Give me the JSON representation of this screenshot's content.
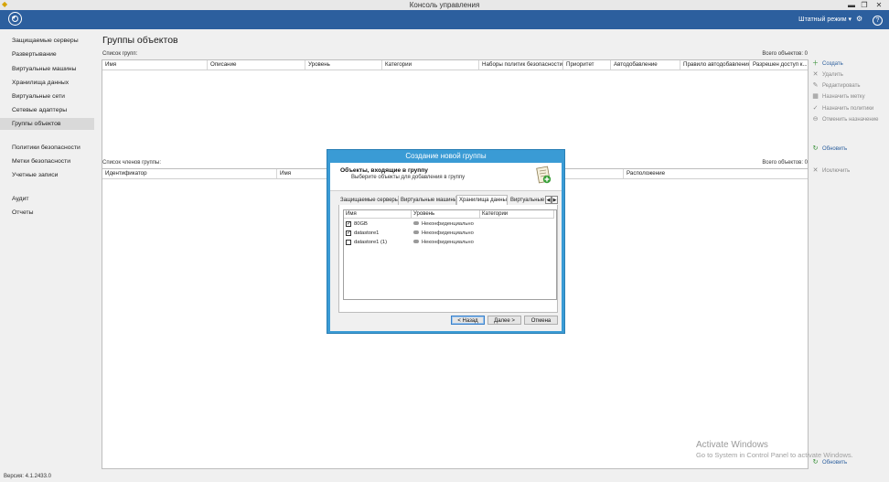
{
  "window": {
    "title": "Консоль управления",
    "minimize": "▬",
    "maximize": "❐",
    "close": "✕"
  },
  "header": {
    "mode_label": "Штатный режим",
    "dropdown_icon": "▾",
    "settings_icon": "⚙",
    "help_icon": "?"
  },
  "sidebar": {
    "items": [
      {
        "label": "Защищаемые серверы"
      },
      {
        "label": "Развертывание"
      },
      {
        "label": "Виртуальные машины"
      },
      {
        "label": "Хранилища данных"
      },
      {
        "label": "Виртуальные сети"
      },
      {
        "label": "Сетевые адаптеры"
      },
      {
        "label": "Группы объектов"
      },
      {
        "label": "Политики безопасности"
      },
      {
        "label": "Метки безопасности"
      },
      {
        "label": "Учетные записи"
      },
      {
        "label": "Аудит"
      },
      {
        "label": "Отчеты"
      }
    ]
  },
  "main": {
    "title": "Группы объектов",
    "groups_label": "Список групп:",
    "groups_count": "Всего объектов: 0",
    "groups_columns": [
      "Имя",
      "Описание",
      "Уровень",
      "Категории",
      "Наборы политик безопасности",
      "Приоритет",
      "Автодобавление",
      "Правило автодобавления",
      "Разрешен доступ к..."
    ],
    "members_label": "Список членов группы:",
    "members_count": "Всего объектов: 0",
    "members_columns": [
      "Идентификатор",
      "Имя",
      "",
      "Расположение"
    ]
  },
  "actions": {
    "create": "Создать",
    "delete": "Удалить",
    "edit": "Редактировать",
    "assign_label": "Назначить метку",
    "assign_policies": "Назначить политики",
    "cancel_assign": "Отменить назначение",
    "refresh": "Обновить",
    "exclude": "Исключить",
    "refresh_bottom": "Обновить"
  },
  "status": {
    "version": "Версия: 4.1.2433.0"
  },
  "watermark": {
    "line1": "Activate Windows",
    "line2": "Go to System in Control Panel to activate Windows."
  },
  "dialog": {
    "title": "Создание новой группы",
    "heading": "Объекты, входящие в группу",
    "subheading": "Выберите объекты для добавления в группу",
    "tabs": [
      "Защищаемые серверы",
      "Виртуальные машины",
      "Хранилища данных",
      "Виртуальные"
    ],
    "selected_tab": "Хранилища данных",
    "tab_prev": "◀",
    "tab_next": "▶",
    "columns": [
      "Имя",
      "Уровень",
      "Категории"
    ],
    "rows": [
      {
        "name": "80GB",
        "checked": true,
        "level": "Неконфиденциально"
      },
      {
        "name": "datastore1",
        "checked": true,
        "level": "Неконфиденциально"
      },
      {
        "name": "datastore1 (1)",
        "checked": false,
        "level": "Неконфиденциально"
      }
    ],
    "check_mark": "✓",
    "buttons": {
      "back": "< Назад",
      "next": "Далее >",
      "cancel": "Отмена"
    }
  }
}
